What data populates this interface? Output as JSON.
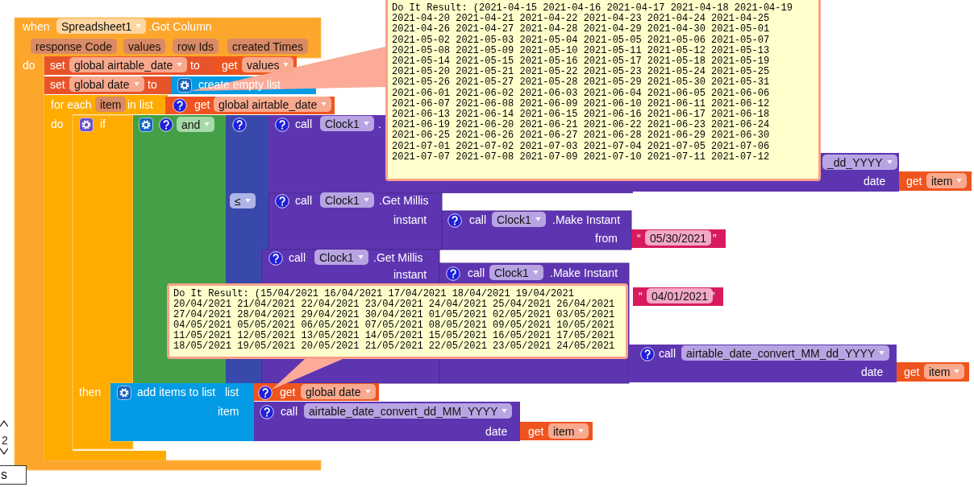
{
  "event": {
    "keyword": "when",
    "component": "Spreadsheet1",
    "event_name": ".Got Column",
    "parameters": [
      "response Code",
      "values",
      "row Ids",
      "created Times"
    ],
    "do_label": "do"
  },
  "set_blocks": [
    {
      "keyword": "set",
      "variable": "global airtable_date",
      "to_label": "to"
    },
    {
      "keyword": "set",
      "variable": "global date",
      "to_label": "to"
    }
  ],
  "values_getter": {
    "keyword": "get",
    "variable": "values"
  },
  "create_list": {
    "label": "create empty list"
  },
  "for_each": {
    "label": "for each",
    "variable": "item",
    "in_list_label": "in list",
    "do_label": "do"
  },
  "list_getter": {
    "keyword": "get",
    "variable": "global airtable_date"
  },
  "if_block": {
    "label": "if",
    "then_label": "then"
  },
  "and_block": {
    "operator": "and"
  },
  "compare_block": {
    "operator": "≤"
  },
  "clock_calls": [
    {
      "keyword": "call",
      "component": "Clock1",
      "method": "."
    },
    {
      "keyword": "call",
      "component": "Clock1",
      "method": ".Get Millis",
      "argument_label": "instant"
    },
    {
      "keyword": "call",
      "component": "Clock1",
      "method": ".Make Instant",
      "argument_label": "from"
    },
    {
      "keyword": "call",
      "component": "Clock1",
      "method": ".Get Millis",
      "argument_label": "instant"
    },
    {
      "keyword": "call",
      "component": "Clock1",
      "method": ".Make Instant"
    }
  ],
  "string_blocks": [
    {
      "open_quote": "“",
      "value": "05/30/2021",
      "close_quote": "”"
    },
    {
      "open_quote": "“",
      "value": "04/01/2021",
      "close_quote": "”"
    }
  ],
  "convert_calls": [
    {
      "procedure": "_dd_YYYY",
      "argument_label": "date"
    },
    {
      "keyword": "call",
      "procedure": "airtable_date_convert_MM_dd_YYYY",
      "argument_label": "date"
    },
    {
      "keyword": "call",
      "procedure": "airtable_date_convert_dd_MM_YYYY",
      "argument_label": "date"
    }
  ],
  "item_getters": [
    {
      "keyword": "get",
      "variable": "item"
    },
    {
      "keyword": "get",
      "variable": "item"
    },
    {
      "keyword": "get",
      "variable": "item"
    }
  ],
  "add_items": {
    "label": "add items to list",
    "list_label": "list",
    "item_label": "item"
  },
  "date_getter": {
    "keyword": "get",
    "variable": "global date"
  },
  "balloons": [
    {
      "lines": [
        "Do It Result: (2021-04-15 2021-04-16 2021-04-17 2021-04-18 2021-04-19",
        "2021-04-20 2021-04-21 2021-04-22 2021-04-23 2021-04-24 2021-04-25",
        "2021-04-26 2021-04-27 2021-04-28 2021-04-29 2021-04-30 2021-05-01",
        "2021-05-02 2021-05-03 2021-05-04 2021-05-05 2021-05-06 2021-05-07",
        "2021-05-08 2021-05-09 2021-05-10 2021-05-11 2021-05-12 2021-05-13",
        "2021-05-14 2021-05-15 2021-05-16 2021-05-17 2021-05-18 2021-05-19",
        "2021-05-20 2021-05-21 2021-05-22 2021-05-23 2021-05-24 2021-05-25",
        "2021-05-26 2021-05-27 2021-05-28 2021-05-29 2021-05-30 2021-05-31",
        "2021-06-01 2021-06-02 2021-06-03 2021-06-04 2021-06-05 2021-06-06",
        "2021-06-07 2021-06-08 2021-06-09 2021-06-10 2021-06-11 2021-06-12",
        "2021-06-13 2021-06-14 2021-06-15 2021-06-16 2021-06-17 2021-06-18",
        "2021-06-19 2021-06-20 2021-06-21 2021-06-22 2021-06-23 2021-06-24",
        "2021-06-25 2021-06-26 2021-06-27 2021-06-28 2021-06-29 2021-06-30",
        "2021-07-01 2021-07-02 2021-07-03 2021-07-04 2021-07-05 2021-07-06",
        "2021-07-07 2021-07-08 2021-07-09 2021-07-10 2021-07-11 2021-07-12"
      ]
    },
    {
      "lines": [
        "Do It Result: (15/04/2021 16/04/2021 17/04/2021 18/04/2021 19/04/2021",
        "20/04/2021 21/04/2021 22/04/2021 23/04/2021 24/04/2021 25/04/2021 26/04/2021",
        "27/04/2021 28/04/2021 29/04/2021 30/04/2021 01/05/2021 02/05/2021 03/05/2021",
        "04/05/2021 05/05/2021 06/05/2021 07/05/2021 08/05/2021 09/05/2021 10/05/2021",
        "11/05/2021 12/05/2021 13/05/2021 14/05/2021 15/05/2021 16/05/2021 17/05/2021",
        "18/05/2021 19/05/2021 20/05/2021 21/05/2021 22/05/2021 23/05/2021 24/05/2021"
      ]
    }
  ],
  "side_controls": {
    "count": "2",
    "button": "s"
  }
}
